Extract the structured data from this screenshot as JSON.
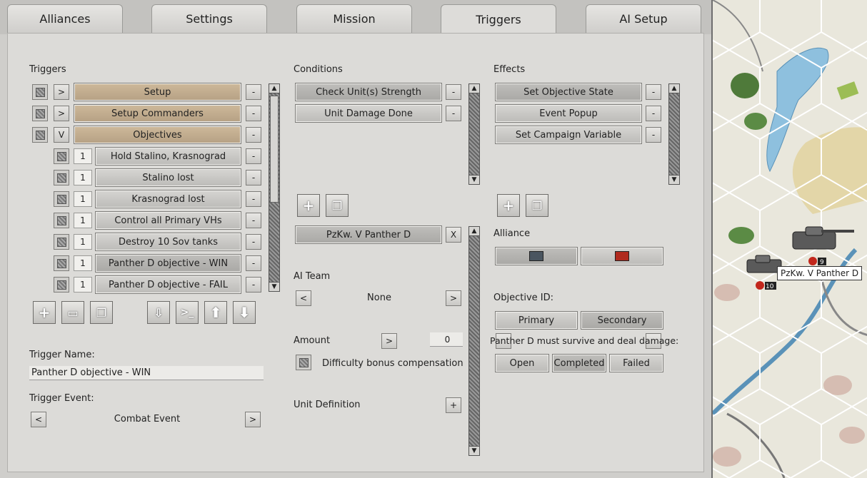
{
  "tabs": [
    {
      "label": "Alliances"
    },
    {
      "label": "Settings"
    },
    {
      "label": "Mission"
    },
    {
      "label": "Triggers"
    },
    {
      "label": "AI Setup"
    }
  ],
  "active_tab": "Triggers",
  "triggers": {
    "heading": "Triggers",
    "items": [
      {
        "toggle": ">",
        "label": "Setup",
        "remove": "-"
      },
      {
        "toggle": ">",
        "label": "Setup Commanders",
        "remove": "-"
      },
      {
        "toggle": "V",
        "label": "Objectives",
        "remove": "-"
      },
      {
        "index": "1",
        "label": "Hold Stalino, Krasnograd",
        "remove": "-"
      },
      {
        "index": "1",
        "label": "Stalino lost",
        "remove": "-"
      },
      {
        "index": "1",
        "label": "Krasnograd lost",
        "remove": "-"
      },
      {
        "index": "1",
        "label": "Control all Primary VHs",
        "remove": "-"
      },
      {
        "index": "1",
        "label": "Destroy 10 Sov tanks",
        "remove": "-"
      },
      {
        "index": "1",
        "label": "Panther D  objective - WIN",
        "remove": "-"
      },
      {
        "index": "1",
        "label": "Panther D  objective - FAIL",
        "remove": "-"
      }
    ],
    "name_label": "Trigger Name:",
    "name_value": "Panther D  objective - WIN",
    "event_label": "Trigger Event:",
    "event_value": "Combat Event",
    "prev": "<",
    "next": ">"
  },
  "conditions": {
    "heading": "Conditions",
    "items": [
      {
        "label": "Check Unit(s) Strength",
        "remove": "-"
      },
      {
        "label": "Unit Damage Done",
        "remove": "-"
      }
    ],
    "unit": {
      "label": "PzKw. V Panther D",
      "remove": "X"
    },
    "ai_team_label": "AI Team",
    "ai_team_value": "None",
    "amount_label": "Amount",
    "amount_btn": ">",
    "amount_value": "0",
    "difficulty_label": "Difficulty bonus compensation",
    "unit_def_label": "Unit Definition",
    "unit_def_btn": "+",
    "prev": "<",
    "next": ">"
  },
  "effects": {
    "heading": "Effects",
    "items": [
      {
        "label": "Set Objective State",
        "remove": "-"
      },
      {
        "label": "Event Popup",
        "remove": "-"
      },
      {
        "label": "Set Campaign Variable",
        "remove": "-"
      }
    ],
    "alliance_label": "Alliance",
    "alliance_colors": [
      "#4a5560",
      "#b02a1e"
    ],
    "objective_id_label": "Objective ID:",
    "objective_types": [
      {
        "label": "Primary"
      },
      {
        "label": "Secondary"
      }
    ],
    "objective_text": "Panther D must survive and deal damage:",
    "states": [
      {
        "label": "Open"
      },
      {
        "label": "Completed"
      },
      {
        "label": "Failed"
      }
    ]
  },
  "map": {
    "tooltip": "PzKw. V Panther D",
    "badge_a": "9",
    "badge_b": "10"
  }
}
